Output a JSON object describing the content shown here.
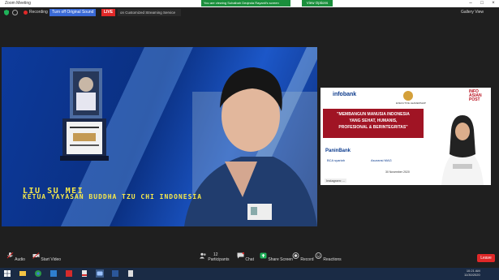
{
  "window": {
    "title": "Zoom Meeting"
  },
  "topbar": {
    "recording_label": "Recording",
    "group_chip": "Turn off Original Sound",
    "live_label": "LIVE",
    "stream_text": "on Customized Streaming Service",
    "notice": "You are viewing Suhaibah Deqinda Rayanti's screen",
    "view_options": "View Options",
    "gallery_view": "Gallery View"
  },
  "share": {
    "name": "LIU SU MEI",
    "title": "KETUA YAYASAN BUDDHA TZU CHI INDONESIA"
  },
  "thumbnail": {
    "brand": "infobank",
    "brand_sub": "",
    "badge_caption": "EXECUTIVE LEADERSHIP",
    "post_label": "INFO ASIAN POST",
    "banner_line1": "\"MEMBANGUN MANUSIA INDONESIA",
    "banner_line2": "YANG SEHAT, HUMANIS,",
    "banner_line3": "PROFESIONAL & BERINTEGRITAS\"",
    "banner_sub": "",
    "sponsor1": "PaninBank",
    "sponsor2": "BCA syariah",
    "sponsor3": "Asuransi MAG",
    "date": "30 November 2020",
    "pill": "Instagram: ..."
  },
  "toolbar": {
    "audio": "Audio",
    "video": "Start Video",
    "participants": "Participants",
    "participants_count": "12",
    "chat": "Chat",
    "share_screen": "Share Screen",
    "record": "Record",
    "reactions": "Reactions",
    "leave": "Leave"
  },
  "taskbar": {
    "time": "10:21 AM",
    "date": "11/30/2020"
  },
  "colors": {
    "accent": "#1a8f3c",
    "live": "#e02828",
    "zoom_blue": "#3a6ad6",
    "caption_yellow": "#f7e94a",
    "banner_red": "#a01424"
  }
}
